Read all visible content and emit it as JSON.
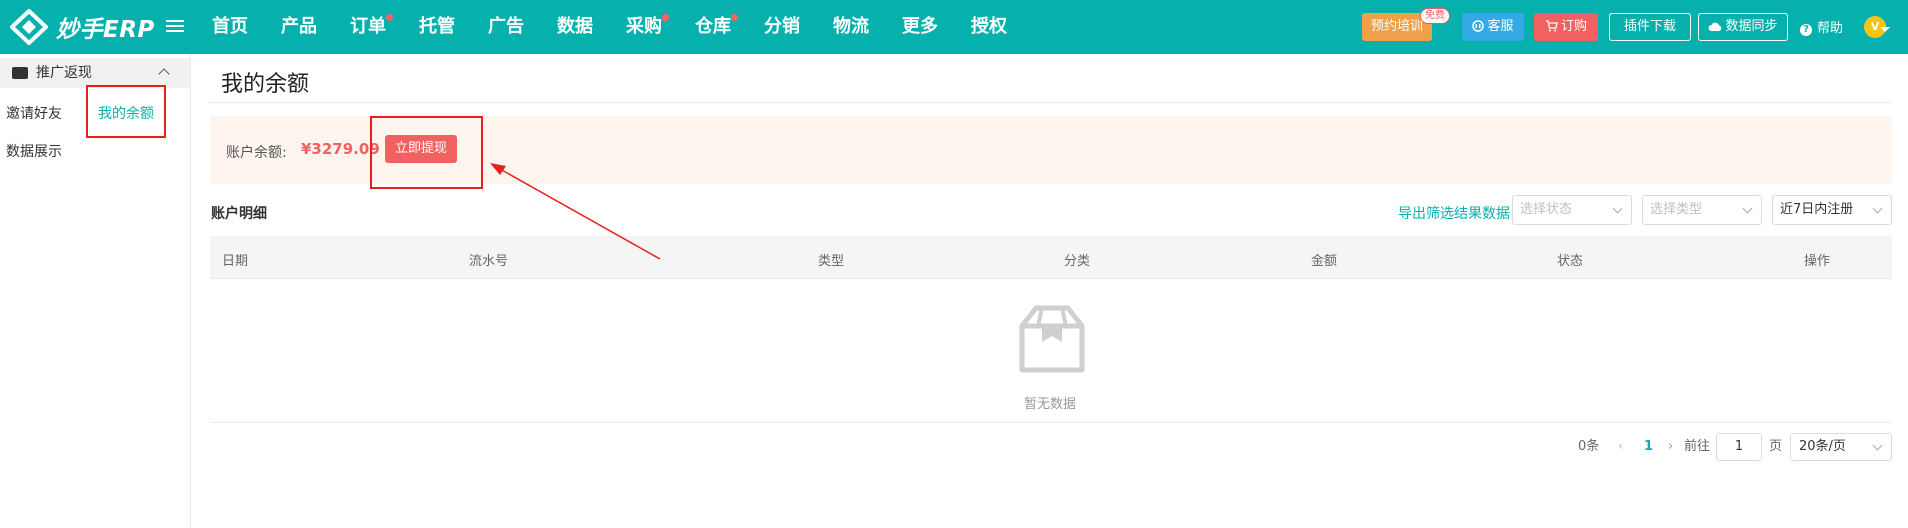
{
  "app": {
    "logo_text": "妙手ERP"
  },
  "nav": {
    "items": [
      {
        "label": "首页"
      },
      {
        "label": "产品"
      },
      {
        "label": "订单"
      },
      {
        "label": "托管"
      },
      {
        "label": "广告"
      },
      {
        "label": "数据"
      },
      {
        "label": "采购"
      },
      {
        "label": "仓库"
      },
      {
        "label": "分销"
      },
      {
        "label": "物流"
      },
      {
        "label": "更多"
      },
      {
        "label": "授权"
      }
    ]
  },
  "toolbar": {
    "training_label": "预约培训",
    "free_badge": "免费",
    "service_label": "客服",
    "order_label": "订购",
    "plugin_label": "插件下载",
    "sync_label": "数据同步",
    "help_label": "帮助",
    "avatar_letter": "V"
  },
  "sidebar": {
    "group_label": "推广返现",
    "items": [
      {
        "label": "邀请好友"
      },
      {
        "label": "我的余额"
      },
      {
        "label": "数据展示"
      }
    ]
  },
  "page": {
    "title": "我的余额",
    "balance_label": "账户余额:",
    "balance_value": "¥3279.09",
    "withdraw_label": "立即提现",
    "detail_title": "账户明细",
    "export_label": "导出筛选结果数据",
    "status_placeholder": "选择状态",
    "type_placeholder": "选择类型",
    "date_filter": "近7日内注册"
  },
  "table": {
    "columns": [
      "日期",
      "流水号",
      "类型",
      "分类",
      "金额",
      "状态",
      "操作"
    ],
    "rows": [],
    "empty_text": "暂无数据"
  },
  "pagination": {
    "total": "0条",
    "current_page": "1",
    "goto_label": "前往",
    "goto_value": "1",
    "page_unit": "页",
    "page_size": "20条/页"
  },
  "colors": {
    "brand": "#06b1ad",
    "accent_red": "#f0615f",
    "highlight_box": "#e8201c"
  }
}
